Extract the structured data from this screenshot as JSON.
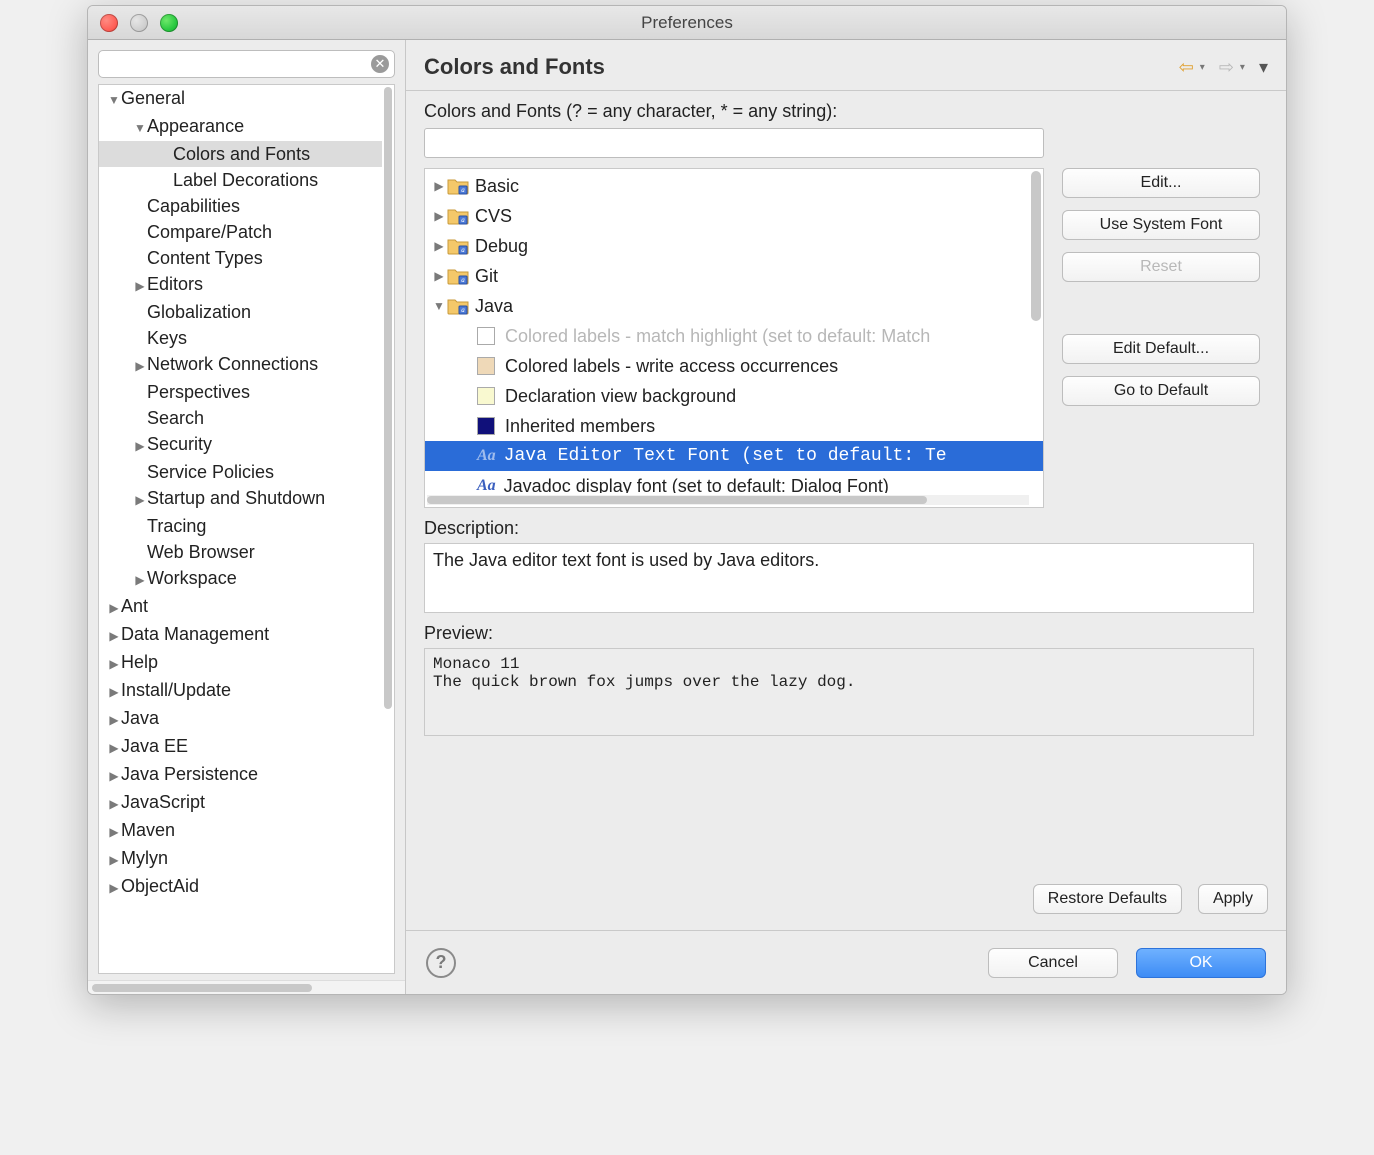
{
  "window": {
    "title": "Preferences"
  },
  "header": {
    "title": "Colors and Fonts"
  },
  "sidebar": {
    "search_placeholder": "",
    "tree": [
      {
        "label": "General",
        "expanded": true,
        "indent": 0,
        "children": [
          {
            "label": "Appearance",
            "expanded": true,
            "indent": 1,
            "children": [
              {
                "label": "Colors and Fonts",
                "indent": 2,
                "selected": true
              },
              {
                "label": "Label Decorations",
                "indent": 2
              }
            ]
          },
          {
            "label": "Capabilities",
            "indent": 1
          },
          {
            "label": "Compare/Patch",
            "indent": 1
          },
          {
            "label": "Content Types",
            "indent": 1
          },
          {
            "label": "Editors",
            "indent": 1,
            "collapsed": true
          },
          {
            "label": "Globalization",
            "indent": 1
          },
          {
            "label": "Keys",
            "indent": 1
          },
          {
            "label": "Network Connections",
            "indent": 1,
            "collapsed": true
          },
          {
            "label": "Perspectives",
            "indent": 1
          },
          {
            "label": "Search",
            "indent": 1
          },
          {
            "label": "Security",
            "indent": 1,
            "collapsed": true
          },
          {
            "label": "Service Policies",
            "indent": 1
          },
          {
            "label": "Startup and Shutdown",
            "indent": 1,
            "collapsed": true
          },
          {
            "label": "Tracing",
            "indent": 1
          },
          {
            "label": "Web Browser",
            "indent": 1
          },
          {
            "label": "Workspace",
            "indent": 1,
            "collapsed": true
          }
        ]
      },
      {
        "label": "Ant",
        "indent": 0,
        "collapsed": true
      },
      {
        "label": "Data Management",
        "indent": 0,
        "collapsed": true
      },
      {
        "label": "Help",
        "indent": 0,
        "collapsed": true
      },
      {
        "label": "Install/Update",
        "indent": 0,
        "collapsed": true
      },
      {
        "label": "Java",
        "indent": 0,
        "collapsed": true
      },
      {
        "label": "Java EE",
        "indent": 0,
        "collapsed": true
      },
      {
        "label": "Java Persistence",
        "indent": 0,
        "collapsed": true
      },
      {
        "label": "JavaScript",
        "indent": 0,
        "collapsed": true
      },
      {
        "label": "Maven",
        "indent": 0,
        "collapsed": true
      },
      {
        "label": "Mylyn",
        "indent": 0,
        "collapsed": true
      },
      {
        "label": "ObjectAid",
        "indent": 0,
        "collapsed": true
      }
    ]
  },
  "main": {
    "filter_label": "Colors and Fonts (? = any character, * = any string):",
    "filter_value": "",
    "categories": [
      {
        "label": "Basic",
        "expanded": false
      },
      {
        "label": "CVS",
        "expanded": false
      },
      {
        "label": "Debug",
        "expanded": false
      },
      {
        "label": "Git",
        "expanded": false
      },
      {
        "label": "Java",
        "expanded": true,
        "items": [
          {
            "type": "color",
            "color": "#ffffff",
            "dim": true,
            "label": "Colored labels - match highlight (set to default: Match"
          },
          {
            "type": "color",
            "color": "#efd9b8",
            "label": "Colored labels - write access occurrences"
          },
          {
            "type": "color",
            "color": "#f9f9d0",
            "label": "Declaration view background"
          },
          {
            "type": "color",
            "color": "#10107a",
            "label": "Inherited members"
          },
          {
            "type": "font",
            "selected": true,
            "mono": true,
            "label": "Java Editor Text Font (set to default: Te"
          },
          {
            "type": "font",
            "label": "Javadoc display font (set to default: Dialog Font)"
          }
        ]
      }
    ],
    "buttons": {
      "edit": "Edit...",
      "use_system": "Use System Font",
      "reset": "Reset",
      "edit_default": "Edit Default...",
      "go_default": "Go to Default"
    },
    "description_label": "Description:",
    "description_text": "The Java editor text font is used by Java editors.",
    "preview_label": "Preview:",
    "preview_text": "Monaco 11\nThe quick brown fox jumps over the lazy dog.",
    "restore_defaults": "Restore Defaults",
    "apply": "Apply"
  },
  "footer": {
    "cancel": "Cancel",
    "ok": "OK"
  }
}
